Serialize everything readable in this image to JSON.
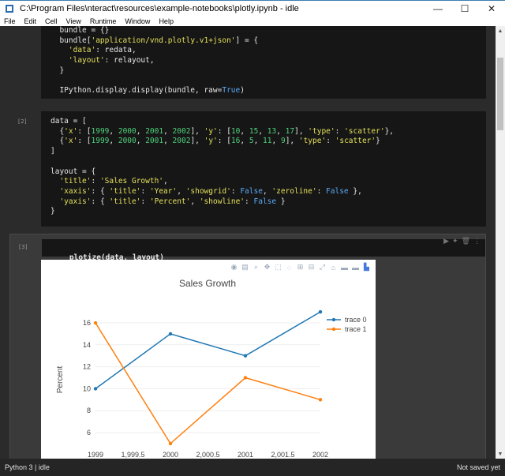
{
  "window": {
    "title": "C:\\Program Files\\nteract\\resources\\example-notebooks\\plotly.ipynb - idle",
    "minimize": "—",
    "maximize": "☐",
    "close": "✕"
  },
  "menu": [
    "File",
    "Edit",
    "Cell",
    "View",
    "Runtime",
    "Window",
    "Help"
  ],
  "cells": {
    "cell1": {
      "lines": [
        "  bundle = {}",
        "  bundle['application/vnd.plotly.v1+json'] = {",
        "    'data': redata,",
        "    'layout': relayout,",
        "  }",
        "",
        "  IPython.display.display(bundle, raw=True)"
      ]
    },
    "cell2": {
      "prompt": "[2]",
      "lines": [
        "data = [",
        "  {'x': [1999, 2000, 2001, 2002], 'y': [10, 15, 13, 17], 'type': 'scatter'},",
        "  {'x': [1999, 2000, 2001, 2002], 'y': [16, 5, 11, 9], 'type': 'scatter'}",
        "]",
        "",
        "layout = {",
        "  'title': 'Sales Growth',",
        "  'xaxis': { 'title': 'Year', 'showgrid': False, 'zeroline': False },",
        "  'yaxis': { 'title': 'Percent', 'showline': False }",
        "}"
      ]
    },
    "cell3": {
      "prompt": "[3]",
      "code": "plotize(data, layout)"
    }
  },
  "chart_data": {
    "type": "line",
    "title": "Sales Growth",
    "ylabel": "Percent",
    "xlabel": "",
    "x": [
      1999,
      2000,
      2001,
      2002
    ],
    "x_ticks": [
      "1999",
      "1,999.5",
      "2000",
      "2,000.5",
      "2001",
      "2,001.5",
      "2002"
    ],
    "x_tick_values": [
      1999,
      1999.5,
      2000,
      2000.5,
      2001,
      2001.5,
      2002
    ],
    "y_ticks": [
      6,
      8,
      10,
      12,
      14,
      16
    ],
    "xlim": [
      1999,
      2002
    ],
    "ylim": [
      4.2,
      17.8
    ],
    "grid": "horizontal",
    "legend": "top-right",
    "series": [
      {
        "name": "trace 0",
        "values": [
          10,
          15,
          13,
          17
        ],
        "color": "#1f77b4"
      },
      {
        "name": "trace 1",
        "values": [
          16,
          5,
          11,
          9
        ],
        "color": "#ff7f0e"
      }
    ]
  },
  "status": {
    "left": "Python 3 | idle",
    "right": "Not saved yet"
  }
}
